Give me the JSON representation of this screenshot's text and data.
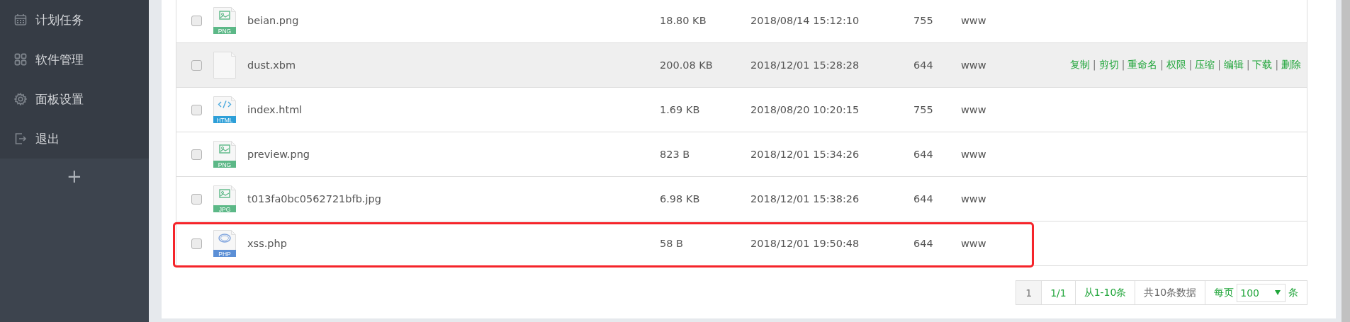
{
  "sidebar": {
    "items": [
      {
        "label": "计划任务",
        "kind": "calendar"
      },
      {
        "label": "软件管理",
        "kind": "grid"
      },
      {
        "label": "面板设置",
        "kind": "gear"
      },
      {
        "label": "退出",
        "kind": "exit"
      }
    ],
    "add_button": "+"
  },
  "files": {
    "action_separator": "|",
    "rows": [
      {
        "name": "beian.png",
        "size": "18.80 KB",
        "modified": "2018/08/14 15:12:10",
        "permission": "755",
        "owner": "www",
        "kind": "image",
        "icon_label": "PNG",
        "checked": false,
        "hovered": false,
        "highlighted": false,
        "actions": []
      },
      {
        "name": "dust.xbm",
        "size": "200.08 KB",
        "modified": "2018/12/01 15:28:28",
        "permission": "644",
        "owner": "www",
        "kind": "blank",
        "checked": false,
        "hovered": true,
        "highlighted": false,
        "actions": [
          "复制",
          "剪切",
          "重命名",
          "权限",
          "压缩",
          "编辑",
          "下载",
          "删除"
        ]
      },
      {
        "name": "index.html",
        "size": "1.69 KB",
        "modified": "2018/08/20 10:20:15",
        "permission": "755",
        "owner": "www",
        "kind": "code",
        "icon_label": "HTML",
        "checked": false,
        "hovered": false,
        "highlighted": false,
        "actions": []
      },
      {
        "name": "preview.png",
        "size": "823 B",
        "modified": "2018/12/01 15:34:26",
        "permission": "644",
        "owner": "www",
        "kind": "image",
        "icon_label": "PNG",
        "checked": false,
        "hovered": false,
        "highlighted": false,
        "actions": []
      },
      {
        "name": "t013fa0bc0562721bfb.jpg",
        "size": "6.98 KB",
        "modified": "2018/12/01 15:38:26",
        "permission": "644",
        "owner": "www",
        "kind": "image",
        "icon_label": "JPG",
        "checked": false,
        "hovered": false,
        "highlighted": false,
        "actions": []
      },
      {
        "name": "xss.php",
        "size": "58 B",
        "modified": "2018/12/01 19:50:48",
        "permission": "644",
        "owner": "www",
        "kind": "php",
        "icon_label": "PHP",
        "checked": false,
        "hovered": false,
        "highlighted": true,
        "actions": []
      }
    ]
  },
  "pagination": {
    "pages": [
      {
        "label": "1",
        "selected": true
      }
    ],
    "page_count": "1/1",
    "range": "从1-10条",
    "total": "共10条数据",
    "per_page_label": "每页",
    "per_page_value": "100",
    "per_page_suffix": "条"
  }
}
